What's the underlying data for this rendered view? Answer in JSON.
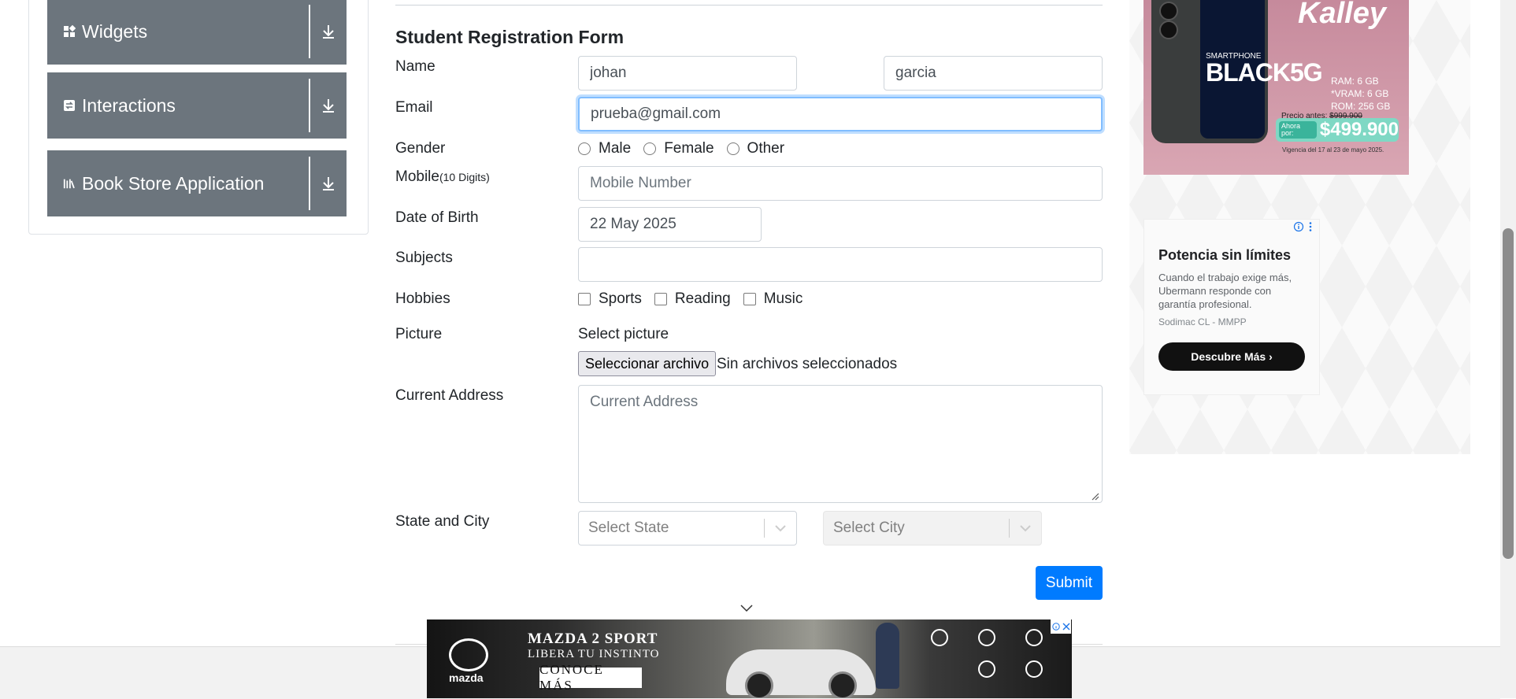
{
  "sidebar": {
    "groups": [
      {
        "label": "Widgets",
        "icon": "widgets-icon"
      },
      {
        "label": "Interactions",
        "icon": "interactions-icon"
      },
      {
        "label": "Book Store Application",
        "icon": "book-store-icon"
      }
    ]
  },
  "form": {
    "title": "Student Registration Form",
    "name_label": "Name",
    "first_name": "johan",
    "last_name": "garcia",
    "email_label": "Email",
    "email": "prueba@gmail.com",
    "gender_label": "Gender",
    "gender_options": [
      "Male",
      "Female",
      "Other"
    ],
    "mobile_label": "Mobile",
    "mobile_hint": "(10 Digits)",
    "mobile_placeholder": "Mobile Number",
    "dob_label": "Date of Birth",
    "dob": "22 May 2025",
    "subjects_label": "Subjects",
    "hobbies_label": "Hobbies",
    "hobbies_options": [
      "Sports",
      "Reading",
      "Music"
    ],
    "picture_label": "Picture",
    "picture_prompt": "Select picture",
    "file_button": "Seleccionar archivo",
    "file_status": "Sin archivos seleccionados",
    "address_label": "Current Address",
    "address_placeholder": "Current Address",
    "state_city_label": "State and City",
    "state_placeholder": "Select State",
    "city_placeholder": "Select City",
    "submit_label": "Submit"
  },
  "right_ad": {
    "brand": "Kalley",
    "model_prefix": "SMARTPHONE",
    "model": "BLACK5G",
    "specs": [
      "RAM: 6 GB",
      "*VRAM: 6 GB",
      "ROM: 256 GB"
    ],
    "before_label": "Precio antes:",
    "before_price": "$999.900",
    "now_label": "Ahora por:",
    "price": "$499.900",
    "validity": "Vigencia del 17 al 23 de mayo 2025."
  },
  "promo_ad": {
    "title": "Potencia sin límites",
    "body": "Cuando el trabajo exige más, Ubermann responde con garantía profesional.",
    "source": "Sodimac CL - MMPP",
    "cta": "Descubre Más"
  },
  "bottom_ad": {
    "brand": "mazda",
    "title": "MAZDA 2 SPORT",
    "subtitle": "LIBERA TU INSTINTO",
    "cta": "CONOCE MÁS"
  },
  "colors": {
    "sidebar_group_bg": "#6c757d",
    "submit_bg": "#007bff",
    "focus_border": "#80bdff"
  }
}
